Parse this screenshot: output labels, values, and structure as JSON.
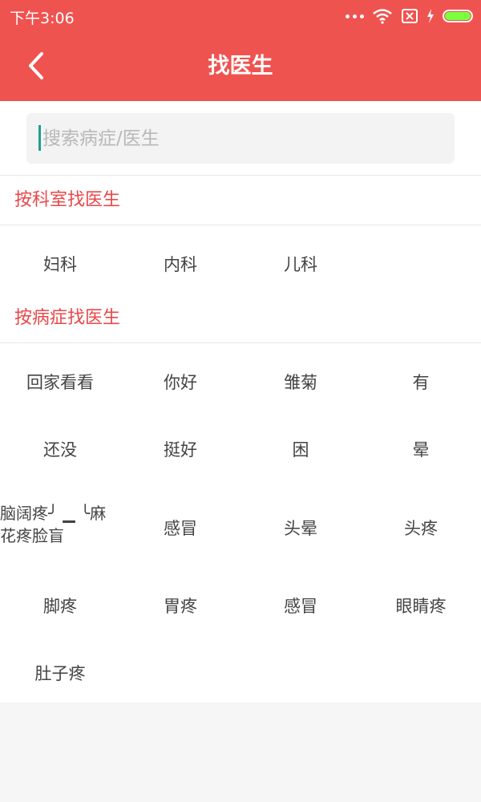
{
  "status_bar": {
    "time": "下午3:06"
  },
  "nav": {
    "title": "找医生"
  },
  "search": {
    "placeholder": "搜索病症/医生",
    "value": ""
  },
  "sections": {
    "by_department": {
      "title": "按科室找医生",
      "items": [
        "妇科",
        "内科",
        "儿科"
      ]
    },
    "by_symptom": {
      "title": "按病症找医生",
      "items": [
        "回家看看",
        "你好",
        "雏菊",
        "有",
        "还没",
        "挺好",
        "困",
        "晕",
        "脑阔疼╯ ▁ ╰麻花疼脸盲",
        "感冒",
        "头晕",
        "头疼",
        "脚疼",
        "胃疼",
        "感冒",
        "眼睛疼",
        "肚子疼"
      ]
    }
  },
  "colors": {
    "accent": "#ef5350",
    "section_title": "#e9484a",
    "battery": "#7cff3c"
  }
}
